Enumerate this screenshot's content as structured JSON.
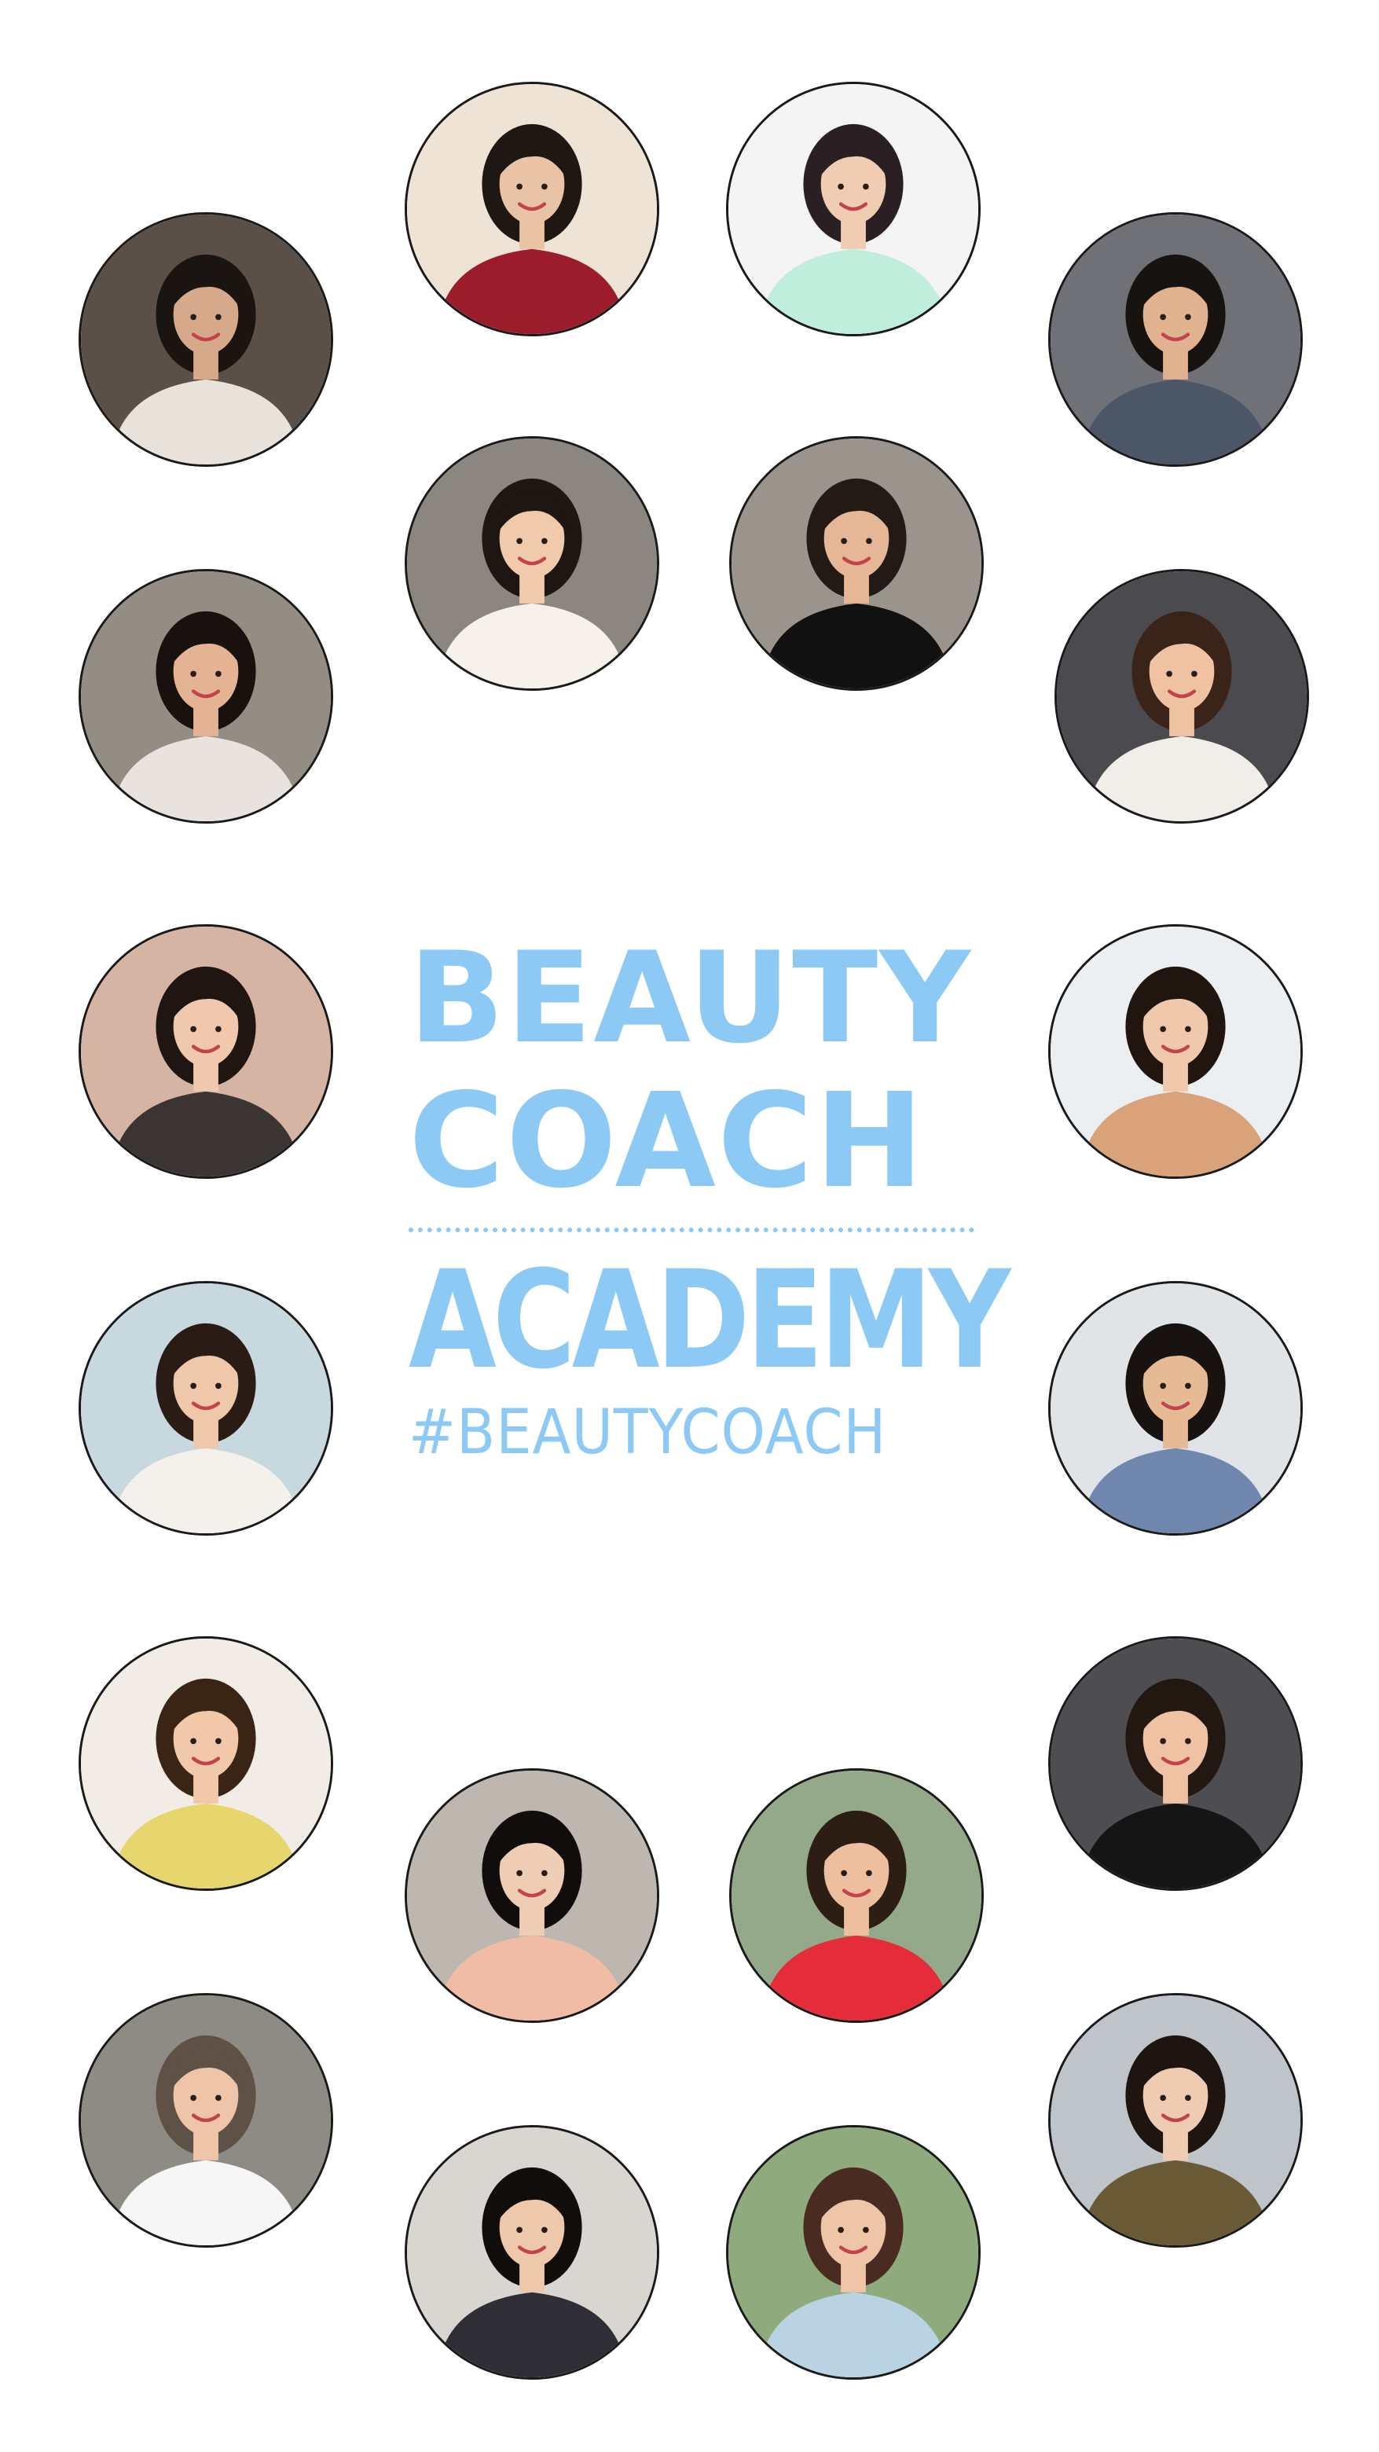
{
  "title": {
    "line1": "BEAUTY",
    "line2": "COACH",
    "line3": "ACADEMY",
    "hashtag": "#BEAUTYCOACH"
  },
  "colors": {
    "title": "#8ccaf5",
    "border": "#1a1a1a",
    "background": "#ffffff"
  },
  "avatars": [
    {
      "bg": "#efe3d6",
      "shirt": "#9b1c2a",
      "hair": "#1f1712",
      "skin": "#e9c3a6"
    },
    {
      "bg": "#f4f4f4",
      "shirt": "#bfeedd",
      "hair": "#2a1f22",
      "skin": "#efccb2"
    },
    {
      "bg": "#5b5048",
      "shirt": "#e8e2da",
      "hair": "#1b1512",
      "skin": "#d7a98b"
    },
    {
      "bg": "#707176",
      "shirt": "#4b5666",
      "hair": "#161311",
      "skin": "#e0b290"
    },
    {
      "bg": "#8b8780",
      "shirt": "#f6f1ea",
      "hair": "#1d1613",
      "skin": "#f1c9ab"
    },
    {
      "bg": "#9a948c",
      "shirt": "#111111",
      "hair": "#231a15",
      "skin": "#e5b796"
    },
    {
      "bg": "#948d84",
      "shirt": "#e9e3e0",
      "hair": "#18110e",
      "skin": "#e4b393"
    },
    {
      "bg": "#4b4b4f",
      "shirt": "#f1ede8",
      "hair": "#3a241a",
      "skin": "#efc3a2"
    },
    {
      "bg": "#d5b4a3",
      "shirt": "#3a3433",
      "hair": "#1f1612",
      "skin": "#efc8ae"
    },
    {
      "bg": "#eceff2",
      "shirt": "#d9a278",
      "hair": "#20160f",
      "skin": "#f0c9ad"
    },
    {
      "bg": "#c8d8df",
      "shirt": "#f4f1ec",
      "hair": "#2a1b15",
      "skin": "#efc7a9"
    },
    {
      "bg": "#e1e4e6",
      "shirt": "#6f87ad",
      "hair": "#181210",
      "skin": "#e6b995"
    },
    {
      "bg": "#f1ece5",
      "shirt": "#e7d66d",
      "hair": "#3a2416",
      "skin": "#f1c8aa"
    },
    {
      "bg": "#4d4d52",
      "shirt": "#151515",
      "hair": "#231711",
      "skin": "#eec2a3"
    },
    {
      "bg": "#bdb7b0",
      "shirt": "#f1bca5",
      "hair": "#110d0c",
      "skin": "#efcdb4"
    },
    {
      "bg": "#94a98a",
      "shirt": "#e52c3b",
      "hair": "#2c1d15",
      "skin": "#edbf9f"
    },
    {
      "bg": "#8e8a84",
      "shirt": "#f6f6f6",
      "hair": "#5f5145",
      "skin": "#efc5aa"
    },
    {
      "bg": "#bfc4cb",
      "shirt": "#6a5b36",
      "hair": "#1f1510",
      "skin": "#efccb1"
    },
    {
      "bg": "#d9d5d1",
      "shirt": "#2f2d35",
      "hair": "#110d0b",
      "skin": "#eec8aa"
    },
    {
      "bg": "#8faa7c",
      "shirt": "#b9d3e3",
      "hair": "#4a2b22",
      "skin": "#efc5a8"
    }
  ]
}
